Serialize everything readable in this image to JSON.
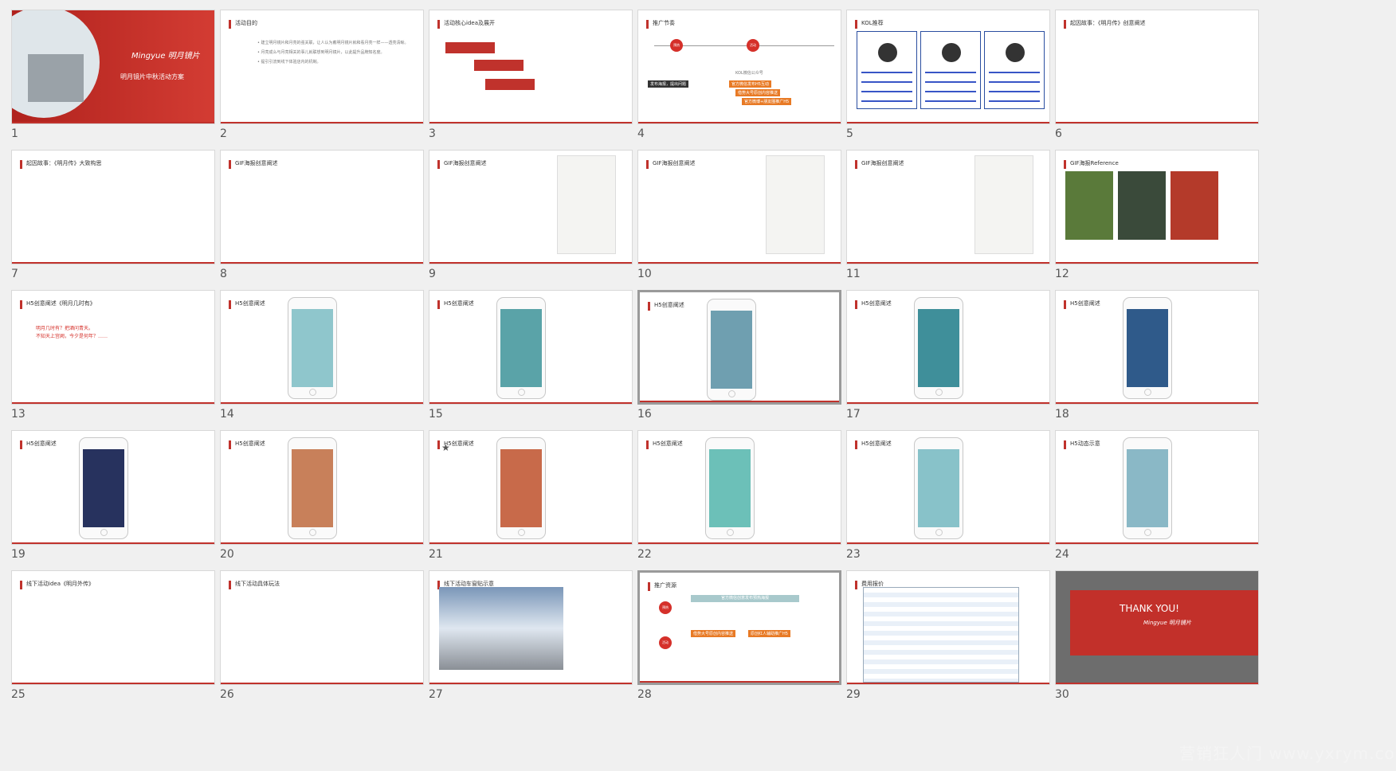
{
  "slides": [
    {
      "num": "1",
      "kind": "cover",
      "logo": "Mingyue 明月镜片",
      "title": "明月镜片中秋活动方案"
    },
    {
      "num": "2",
      "kind": "text",
      "title": "活动目的",
      "lines": [
        "• 建立明月镜片和月亮的强关联，让人认为戴明月镜片就和看月亮一样——透亮清晰。",
        "• 月亮成么与月亮相关的事儿就联想到明月镜片，以此提升品牌知名度。",
        "• 提引引流到线下体验店内的机制。"
      ]
    },
    {
      "num": "3",
      "kind": "idea",
      "title": "活动核心idea及展开"
    },
    {
      "num": "4",
      "kind": "promo",
      "title": "推广节奏"
    },
    {
      "num": "5",
      "kind": "kol",
      "title": "KOL推荐"
    },
    {
      "num": "6",
      "kind": "text",
      "title": "起因故事：《明月传》创意阐述"
    },
    {
      "num": "7",
      "kind": "text",
      "title": "起因故事：《明月传》大致构思"
    },
    {
      "num": "8",
      "kind": "text",
      "title": "GIF海报创意阐述"
    },
    {
      "num": "9",
      "kind": "poster",
      "title": "GIF海报创意阐述"
    },
    {
      "num": "10",
      "kind": "poster",
      "title": "GIF海报创意阐述"
    },
    {
      "num": "11",
      "kind": "poster",
      "title": "GIF海报创意阐述"
    },
    {
      "num": "12",
      "kind": "ref",
      "title": "GIF海报Reference"
    },
    {
      "num": "13",
      "kind": "h5text",
      "title": "H5创意阐述《明月几时有》",
      "red": [
        "明月几时有？把酒问青天。",
        "不知天上宫阙，今夕是何年？……"
      ]
    },
    {
      "num": "14",
      "kind": "phone",
      "title": "H5创意阐述",
      "screen": "#8fc6cc"
    },
    {
      "num": "15",
      "kind": "phone",
      "title": "H5创意阐述",
      "screen": "#5aa3a8"
    },
    {
      "num": "16",
      "kind": "phone",
      "title": "H5创意阐述",
      "screen": "#6f9fb0",
      "selected": true
    },
    {
      "num": "17",
      "kind": "phone",
      "title": "H5创意阐述",
      "screen": "#3f8f9a"
    },
    {
      "num": "18",
      "kind": "phone",
      "title": "H5创意阐述",
      "screen": "#2f5a8a"
    },
    {
      "num": "19",
      "kind": "phone",
      "title": "H5创意阐述",
      "screen": "#27325e"
    },
    {
      "num": "20",
      "kind": "phone",
      "title": "H5创意阐述",
      "screen": "#c8805a"
    },
    {
      "num": "21",
      "kind": "phone",
      "title": "H5创意阐述",
      "screen": "#c86a4a"
    },
    {
      "num": "22",
      "kind": "phone",
      "title": "H5创意阐述",
      "screen": "#6cc0b8"
    },
    {
      "num": "23",
      "kind": "phone",
      "title": "H5创意阐述",
      "screen": "#88c2c9"
    },
    {
      "num": "24",
      "kind": "phone",
      "title": "H5动态示意",
      "screen": "#8ab8c6"
    },
    {
      "num": "25",
      "kind": "text",
      "title": "线下活动idea《明月外传》"
    },
    {
      "num": "26",
      "kind": "text",
      "title": "线下活动具体玩法"
    },
    {
      "num": "27",
      "kind": "photo",
      "title": "线下活动车窗贴示意"
    },
    {
      "num": "28",
      "kind": "promo2",
      "title": "推广资源",
      "selected": true
    },
    {
      "num": "29",
      "kind": "table",
      "title": "费用报价"
    },
    {
      "num": "30",
      "kind": "thanks",
      "thanks": "THANK YOU!",
      "logo": "Mingyue 明月镜片"
    }
  ],
  "promo": {
    "btn1": "预热",
    "btn2": "活动",
    "wechat": "KOL微信公众号",
    "dark": "发布海报，提出问题",
    "tags": [
      "官方微信发布H5互动",
      "借势大号原创内容推送",
      "官方微博+朋友圈推广H5"
    ]
  },
  "promo2": {
    "banner": "官方微信创意发布预热海报",
    "tags": [
      "借势大号原创内容推送",
      "原创红人辅助推广H5"
    ]
  },
  "star": "★",
  "watermark": "营销狂人门 www.yxrym.com",
  "colors": {
    "accent": "#c0322c",
    "orange": "#e87a25",
    "blue": "#2a4ea0"
  }
}
